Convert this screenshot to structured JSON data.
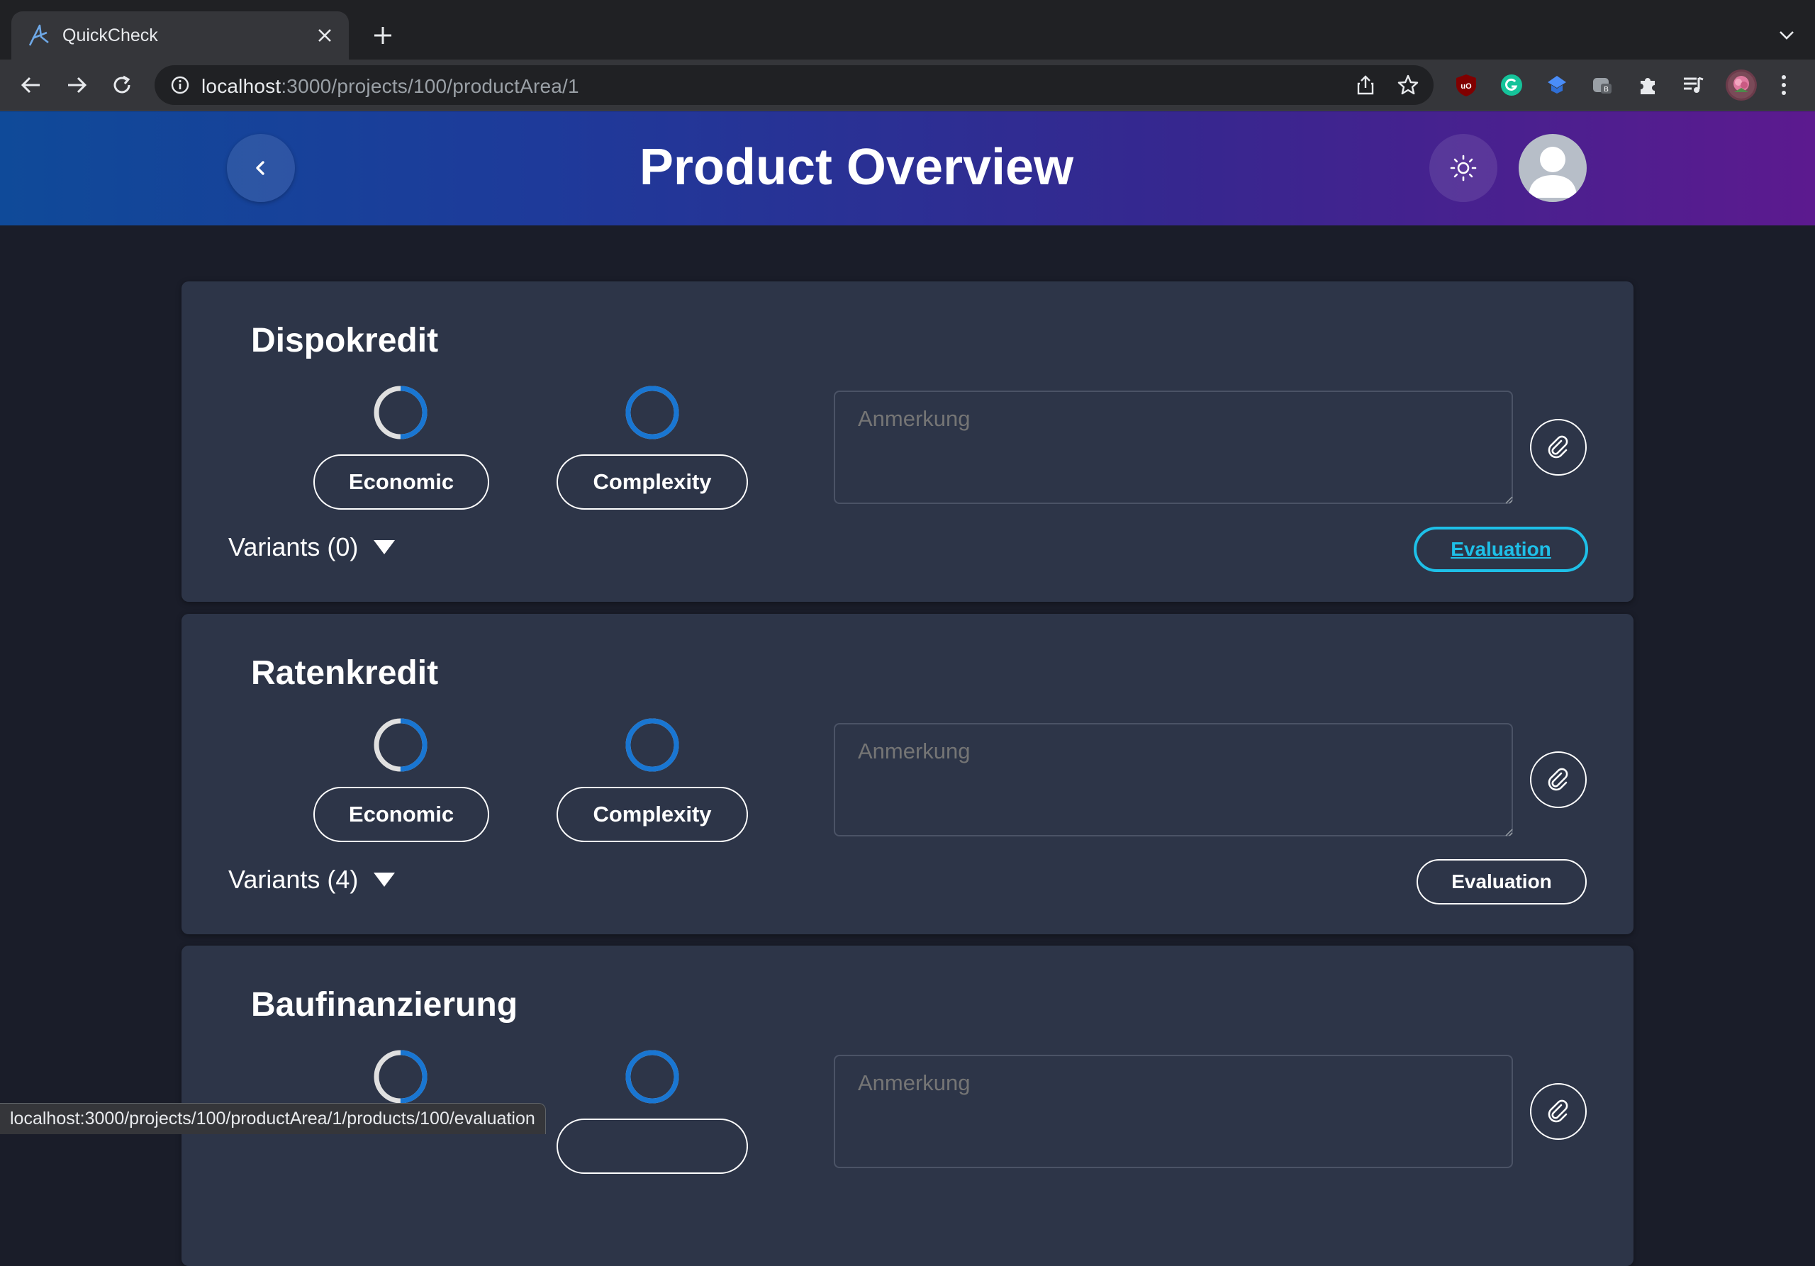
{
  "browser": {
    "tab_title": "QuickCheck",
    "url_host": "localhost",
    "url_path": ":3000/projects/100/productArea/1",
    "status_url": "localhost:3000/projects/100/productArea/1/products/100/evaluation",
    "icons": [
      "back-arrow-icon",
      "forward-arrow-icon",
      "reload-icon",
      "info-icon",
      "share-icon",
      "star-icon",
      "ublock-icon",
      "grammarly-icon",
      "extension-blue-icon",
      "extension-gray-icon",
      "puzzle-icon",
      "media-queue-icon",
      "profile-icon",
      "kebab-menu-icon"
    ]
  },
  "header": {
    "title": "Product Overview",
    "back_icon": "chevron-left-icon",
    "theme_icon": "sun-icon",
    "avatar_icon": "user-avatar-icon",
    "gradient": [
      "#0f4a99",
      "#5c1a8f"
    ]
  },
  "colors": {
    "accent": "#1976d2",
    "focus": "#1ec0e8",
    "card_bg": "#2d3548",
    "page_bg": "#1a1d29"
  },
  "products": [
    {
      "name": "Dispokredit",
      "economic_label": "Economic",
      "complexity_label": "Complexity",
      "economic_progress": 0.5,
      "complexity_progress": 1.0,
      "note_placeholder": "Anmerkung",
      "variants_label": "Variants (0)",
      "evaluation_label": "Evaluation"
    },
    {
      "name": "Ratenkredit",
      "economic_label": "Economic",
      "complexity_label": "Complexity",
      "economic_progress": 0.5,
      "complexity_progress": 1.0,
      "note_placeholder": "Anmerkung",
      "variants_label": "Variants (4)",
      "evaluation_label": "Evaluation"
    },
    {
      "name": "Baufinanzierung",
      "economic_progress": 0.5,
      "complexity_progress": 1.0,
      "note_placeholder": "Anmerkung"
    }
  ]
}
